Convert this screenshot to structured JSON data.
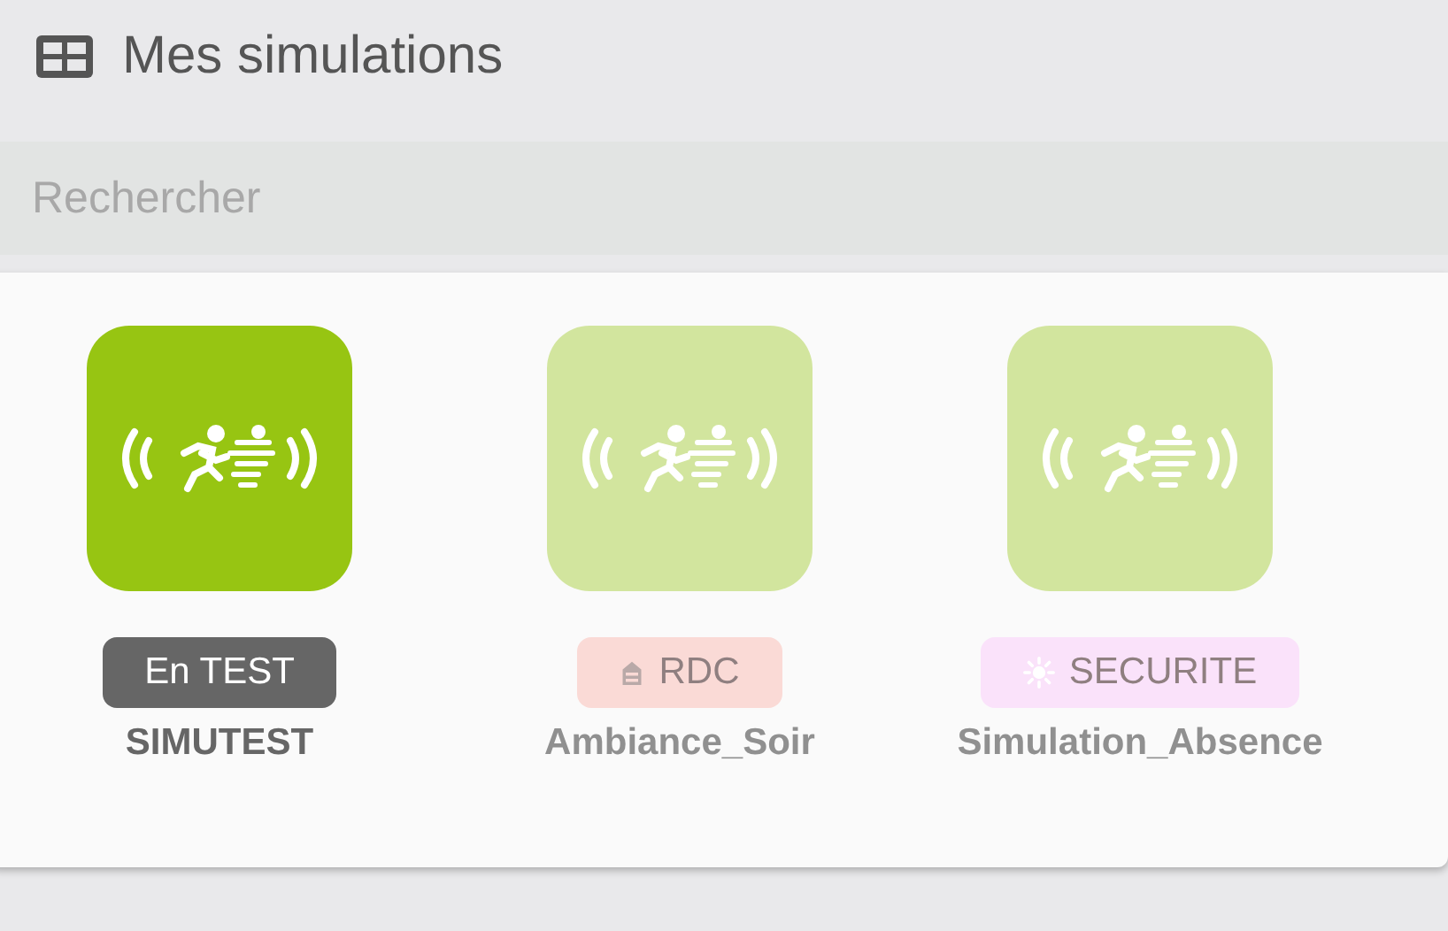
{
  "header": {
    "title": "Mes simulations"
  },
  "search": {
    "placeholder": "Rechercher"
  },
  "simulations": [
    {
      "name": "SIMUTEST",
      "disabled": false,
      "tag": {
        "kind": "plain",
        "label": "En TEST",
        "color": "#666666"
      }
    },
    {
      "name": "Ambiance_Soir",
      "disabled": true,
      "tag": {
        "kind": "floor",
        "label": "RDC",
        "color": "#fadad6"
      }
    },
    {
      "name": "Simulation_Absence",
      "disabled": true,
      "tag": {
        "kind": "sun",
        "label": "SECURITE",
        "color": "#fae2fa"
      }
    }
  ]
}
